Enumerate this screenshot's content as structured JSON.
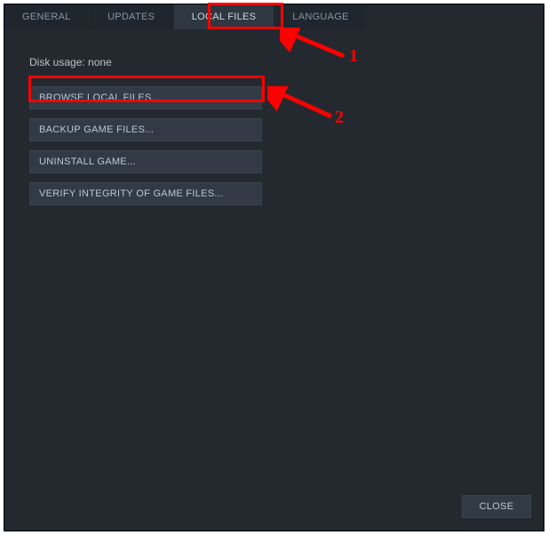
{
  "tabs": {
    "general": "GENERAL",
    "updates": "UPDATES",
    "local_files": "LOCAL FILES",
    "language": "LANGUAGE"
  },
  "disk_usage_label": "Disk usage:",
  "disk_usage_value": "none",
  "actions": {
    "browse": "BROWSE LOCAL FILES...",
    "backup": "BACKUP GAME FILES...",
    "uninstall": "UNINSTALL GAME...",
    "verify": "VERIFY INTEGRITY OF GAME FILES..."
  },
  "close": "CLOSE",
  "annotations": {
    "label1": "1",
    "label2": "2"
  }
}
